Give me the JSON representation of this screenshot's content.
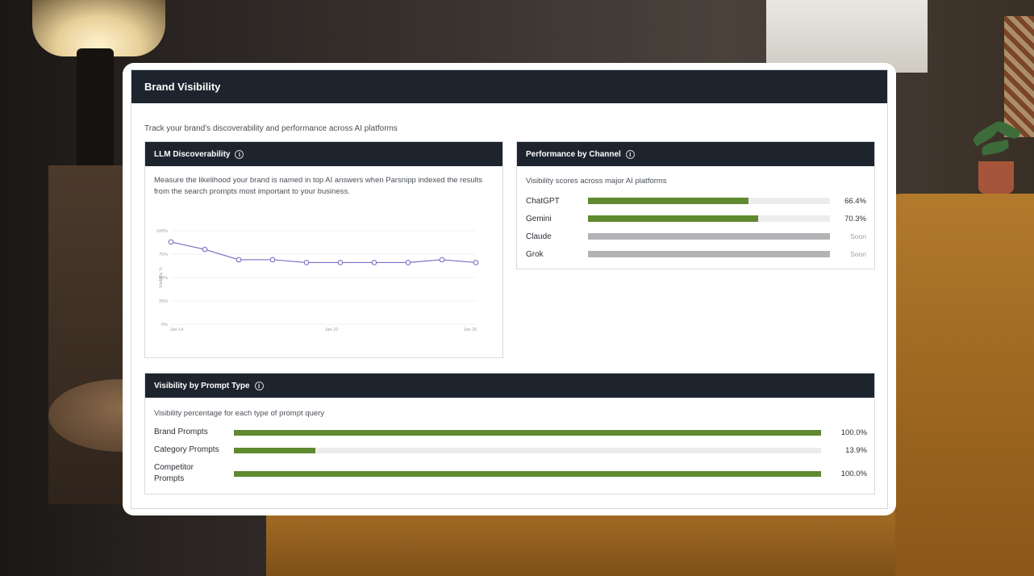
{
  "dashboard": {
    "title": "Brand Visibility",
    "subtitle": "Track your brand's discoverability and performance across AI platforms"
  },
  "llm_panel": {
    "title": "LLM Discoverability",
    "info_icon": "info-icon",
    "description": "Measure the likelihood your brand is named in top AI answers when Parsnipp indexed the results from the search prompts most important to your business."
  },
  "channel_panel": {
    "title": "Performance by Channel",
    "info_icon": "info-icon",
    "description": "Visibility scores across major AI platforms",
    "rows": [
      {
        "name": "ChatGPT",
        "value": "66.4%",
        "fraction": 0.664,
        "status": "active"
      },
      {
        "name": "Gemini",
        "value": "70.3%",
        "fraction": 0.703,
        "status": "active"
      },
      {
        "name": "Claude",
        "value": "Soon",
        "fraction": 1.0,
        "status": "soon"
      },
      {
        "name": "Grok",
        "value": "Soon",
        "fraction": 1.0,
        "status": "soon"
      }
    ]
  },
  "prompt_panel": {
    "title": "Visibility by Prompt Type",
    "info_icon": "info-icon",
    "description": "Visibility percentage for each type of prompt query",
    "rows": [
      {
        "name": "Brand Prompts",
        "value": "100.0%",
        "fraction": 1.0
      },
      {
        "name": "Category Prompts",
        "value": "13.9%",
        "fraction": 0.139
      },
      {
        "name": "Competitor Prompts",
        "value": "100.0%",
        "fraction": 1.0
      }
    ]
  },
  "colors": {
    "header_bg": "#1e242e",
    "bar_fill": "#5f8a2f",
    "bar_track": "#ececec",
    "bar_soon": "#b3b3b6",
    "line": "#7c6fc4"
  },
  "chart_data": {
    "type": "line",
    "ylabel": "Visibility %",
    "ylim": [
      0,
      100
    ],
    "yticks": [
      "0%",
      "25%",
      "50%",
      "75%",
      "100%"
    ],
    "xticks": [
      "Jan 14",
      "Jan 22",
      "Jan 26"
    ],
    "series": [
      {
        "values": [
          88,
          80,
          69,
          69,
          66,
          66,
          66,
          66,
          69,
          66
        ]
      }
    ],
    "grid": true,
    "legend": "none"
  }
}
